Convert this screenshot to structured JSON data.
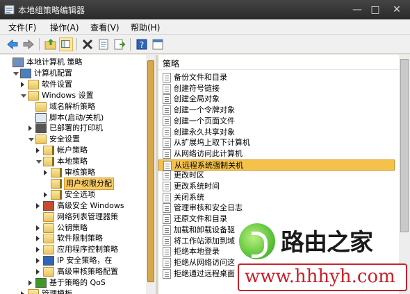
{
  "window": {
    "title": "本地组策略编辑器",
    "controls": {
      "minimize": "—",
      "maximize": "□",
      "close": "✕"
    }
  },
  "menu": [
    {
      "label": "文件(F)"
    },
    {
      "label": "操作(A)"
    },
    {
      "label": "查看(V)"
    },
    {
      "label": "帮助(H)"
    }
  ],
  "toolbar": [
    {
      "icon": "back-arrow-icon"
    },
    {
      "icon": "forward-arrow-icon"
    },
    {
      "icon": "up-folder-icon"
    },
    {
      "icon": "show-tree-icon",
      "active": true
    },
    {
      "icon": "delete-icon"
    },
    {
      "icon": "properties-icon"
    },
    {
      "icon": "export-list-icon"
    },
    {
      "icon": "help-icon"
    },
    {
      "icon": "console-icon"
    }
  ],
  "tree": {
    "items": [
      {
        "label": "本地计算机 策略",
        "level": 0,
        "expander": "none",
        "icon": "computer-policy-icon"
      },
      {
        "label": "计算机配置",
        "level": 1,
        "expander": "open",
        "icon": "computer-icon"
      },
      {
        "label": "软件设置",
        "level": 2,
        "expander": "closed",
        "icon": "folder-icon"
      },
      {
        "label": "Windows 设置",
        "level": 2,
        "expander": "open",
        "icon": "folder-icon"
      },
      {
        "label": "域名解析策略",
        "level": 3,
        "expander": "none",
        "icon": "folder-icon"
      },
      {
        "label": "脚本(启动/关机)",
        "level": 3,
        "expander": "none",
        "icon": "script-icon"
      },
      {
        "label": "已部署的打印机",
        "level": 3,
        "expander": "closed",
        "icon": "printer-icon"
      },
      {
        "label": "安全设置",
        "level": 3,
        "expander": "open",
        "icon": "security-icon"
      },
      {
        "label": "帐户策略",
        "level": 4,
        "expander": "closed",
        "icon": "folder-lock-icon"
      },
      {
        "label": "本地策略",
        "level": 4,
        "expander": "open",
        "icon": "folder-lock-icon"
      },
      {
        "label": "审核策略",
        "level": 5,
        "expander": "closed",
        "icon": "folder-lock-icon"
      },
      {
        "label": "用户权限分配",
        "level": 5,
        "expander": "none",
        "icon": "folder-lock-icon",
        "selected": true
      },
      {
        "label": "安全选项",
        "level": 5,
        "expander": "closed",
        "icon": "folder-lock-icon"
      },
      {
        "label": "高级安全 Windows",
        "level": 4,
        "expander": "closed",
        "icon": "firewall-icon"
      },
      {
        "label": "网络列表管理器策",
        "level": 4,
        "expander": "none",
        "icon": "folder-icon"
      },
      {
        "label": "公钥策略",
        "level": 4,
        "expander": "closed",
        "icon": "folder-icon"
      },
      {
        "label": "软件限制策略",
        "level": 4,
        "expander": "closed",
        "icon": "folder-icon"
      },
      {
        "label": "应用程序控制策略",
        "level": 4,
        "expander": "closed",
        "icon": "folder-icon"
      },
      {
        "label": "IP 安全策略，在",
        "level": 4,
        "expander": "closed",
        "icon": "ip-security-icon"
      },
      {
        "label": "高级审核策略配置",
        "level": 4,
        "expander": "closed",
        "icon": "folder-icon"
      },
      {
        "label": "基于策略的 QoS",
        "level": 3,
        "expander": "closed",
        "icon": "qos-chart-icon"
      },
      {
        "label": "管理模板",
        "level": 2,
        "expander": "closed",
        "icon": "folder-icon"
      }
    ]
  },
  "list": {
    "header": "策略",
    "rows": [
      {
        "label": "备份文件和目录"
      },
      {
        "label": "创建符号链接"
      },
      {
        "label": "创建全局对象"
      },
      {
        "label": "创建一个令牌对象"
      },
      {
        "label": "创建一个页面文件"
      },
      {
        "label": "创建永久共享对象"
      },
      {
        "label": "从扩展坞上取下计算机"
      },
      {
        "label": "从网络访问此计算机"
      },
      {
        "label": "从远程系统强制关机",
        "selected": true
      },
      {
        "label": "更改时区"
      },
      {
        "label": "更改系统时间"
      },
      {
        "label": "关闭系统"
      },
      {
        "label": "管理审核和安全日志"
      },
      {
        "label": "还原文件和目录"
      },
      {
        "label": "加载和卸载设备驱"
      },
      {
        "label": "将工作站添加到域"
      },
      {
        "label": "拒绝本地登录"
      },
      {
        "label": "拒绝从网络访问这"
      },
      {
        "label": "拒绝通过远程桌面"
      }
    ]
  },
  "watermark": {
    "brand": "路由之家",
    "url": "www.hhhyh.com",
    "logo": "router-home-logo"
  }
}
